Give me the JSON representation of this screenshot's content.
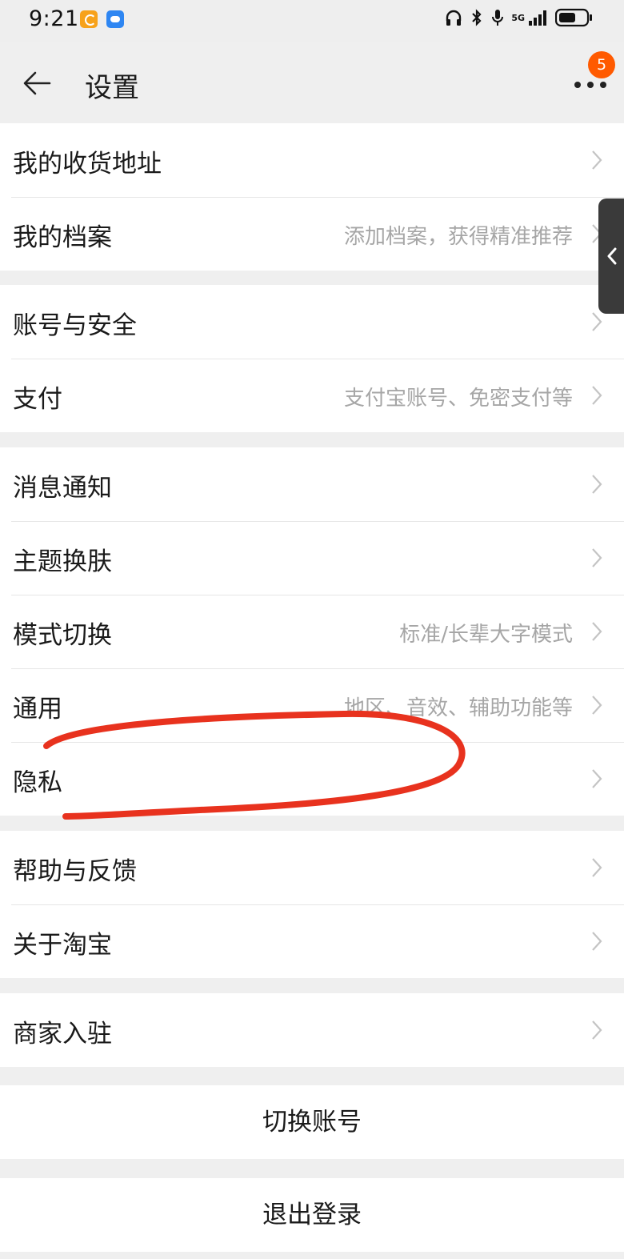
{
  "status_bar": {
    "time": "9:21",
    "network": "5G",
    "icons": [
      "headphones-icon",
      "bluetooth-icon",
      "mic-icon",
      "signal-icon",
      "battery-icon"
    ]
  },
  "header": {
    "title": "设置",
    "back_icon": "arrow-left-icon",
    "more_icon": "more-dots-icon",
    "badge_count": "5"
  },
  "groups": [
    {
      "rows": [
        {
          "label": "我的收货地址",
          "hint": ""
        },
        {
          "label": "我的档案",
          "hint": "添加档案，获得精准推荐"
        }
      ]
    },
    {
      "rows": [
        {
          "label": "账号与安全",
          "hint": ""
        },
        {
          "label": "支付",
          "hint": "支付宝账号、免密支付等"
        }
      ]
    },
    {
      "rows": [
        {
          "label": "消息通知",
          "hint": ""
        },
        {
          "label": "主题换肤",
          "hint": ""
        },
        {
          "label": "模式切换",
          "hint": "标准/长辈大字模式"
        },
        {
          "label": "通用",
          "hint": "地区、音效、辅助功能等"
        },
        {
          "label": "隐私",
          "hint": ""
        }
      ]
    },
    {
      "rows": [
        {
          "label": "帮助与反馈",
          "hint": ""
        },
        {
          "label": "关于淘宝",
          "hint": ""
        }
      ]
    },
    {
      "rows": [
        {
          "label": "商家入驻",
          "hint": ""
        }
      ]
    }
  ],
  "actions": {
    "switch_account": "切换账号",
    "logout": "退出登录"
  },
  "colors": {
    "background": "#efefef",
    "badge": "#ff5a00",
    "annotation": "#e8321e",
    "hint_text": "#a6a6a6"
  }
}
